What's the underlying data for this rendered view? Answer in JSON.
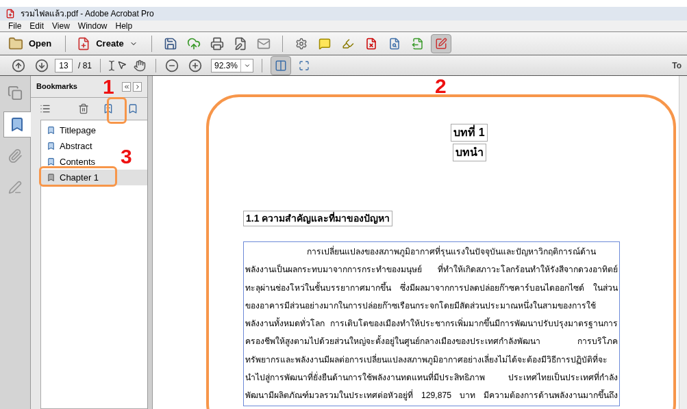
{
  "window": {
    "title": "รวมไฟลแล้ว.pdf - Adobe Acrobat Pro"
  },
  "menu": [
    "File",
    "Edit",
    "View",
    "Window",
    "Help"
  ],
  "toolbar": {
    "open": "Open",
    "create": "Create",
    "form_edit_pressed": true
  },
  "nav": {
    "page": "13",
    "total": "/ 81",
    "zoom": "92.3%",
    "tools_cut": "To"
  },
  "sidebar": {
    "tabs": [
      {
        "kind": "pages",
        "selected": false
      },
      {
        "kind": "bookmarks",
        "selected": true
      },
      {
        "kind": "attachments",
        "selected": false
      },
      {
        "kind": "signatures",
        "selected": false
      }
    ]
  },
  "bookmarks": {
    "title": "Bookmarks",
    "items": [
      {
        "label": "Titlepage",
        "selected": false
      },
      {
        "label": "Abstract",
        "selected": false
      },
      {
        "label": "Contents",
        "selected": false
      },
      {
        "label": "Chapter 1",
        "selected": true
      }
    ]
  },
  "document": {
    "chapter": "บทที่ 1",
    "chapter_title": "บทนำ",
    "heading": "1.1 ความสำคัญและที่มาของปัญหา",
    "lines": [
      "การเปลี่ยนแปลงของสภาพภูมิอากาศที่รุนแรงในปัจจุบันและปัญหาวิกฤติการณ์ด้าน",
      "พลังงานเป็นผลกระทบมาจากการกระทำของมนุษย์ ที่ทำให้เกิดสภาวะโลกร้อนทำให้รังสีจากดวงอาทิตย์",
      "ทะลุผ่านช่องโหว่ในชั้นบรรยากาศมากขึ้น ซึ่งมีผลมาจากการปลดปล่อยก๊าซคาร์บอนไดออกไซด์ ในส่วน",
      "ของอาคารมีส่วนอย่างมากในการปล่อยก๊าซเรือนกระจกโดยมีสัดส่วนประมาณหนึ่งในสามของการใช้",
      "พลังงานทั้งหมดทั่วโลก การเติบโตของเมืองทำให้ประชากรเพิ่มมากขึ้นมีการพัฒนาปรับปรุงมาตรฐานการ",
      "ครองชีพให้สูงตามไปด้วยส่วนใหญ่จะตั้งอยู่ในศูนย์กลางเมืองของประเทศกำลังพัฒนา การบริโภค",
      "ทรัพยากรและพลังงานมีผลต่อการเปลี่ยนแปลงสภาพภูมิอากาศอย่างเลี่ยงไม่ได้จะต้องมีวิธีการปฏิบัติที่จะ",
      "นำไปสู่การพัฒนาที่ยั่งยืนด้านการใช้พลังงานทดแทนที่มีประสิทธิภาพ ประเทศไทยเป็นประเทศที่กำลัง",
      "พัฒนามีผลิตภัณฑ์มวลรวมในประเทศต่อหัวอยู่ที่ 129,875 บาท มีความต้องการด้านพลังงานมากขึ้นถึง"
    ]
  },
  "annotations": [
    {
      "label": "1"
    },
    {
      "label": "2"
    },
    {
      "label": "3"
    }
  ]
}
